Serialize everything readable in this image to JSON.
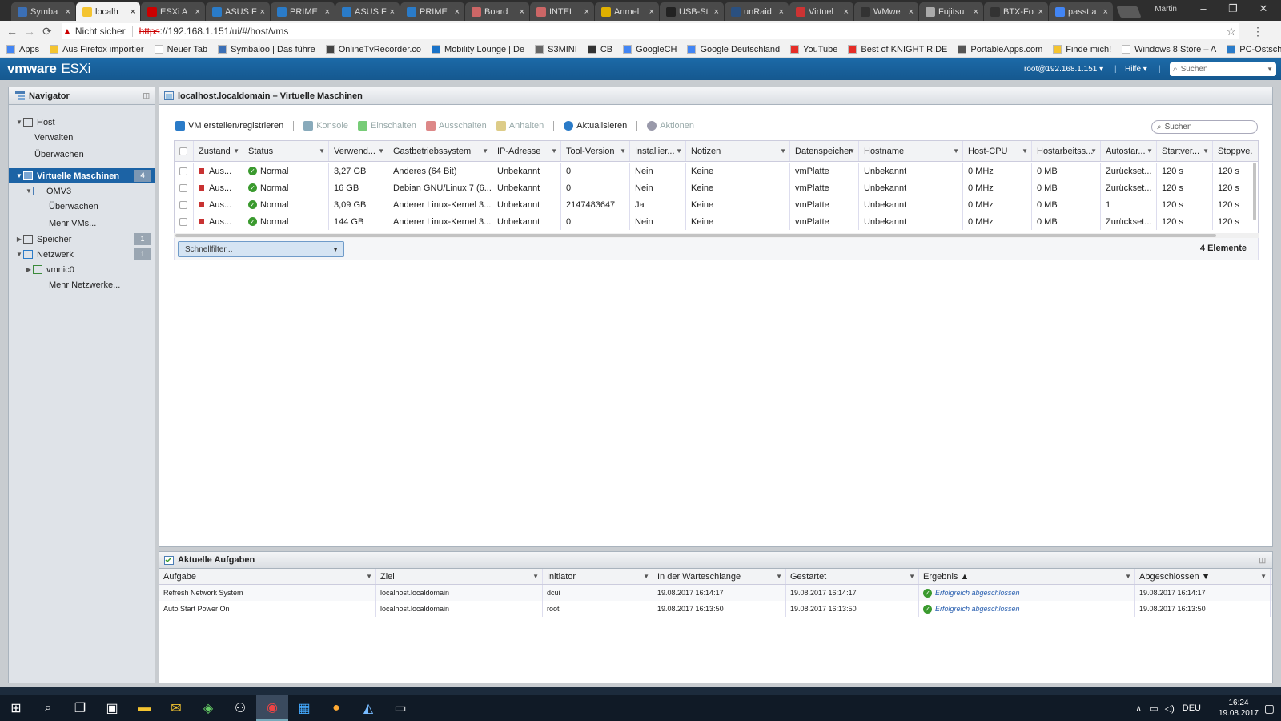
{
  "browser": {
    "tabs": [
      {
        "label": "Symba",
        "icon": "symbaloo",
        "active": false
      },
      {
        "label": "localh",
        "icon": "vmware",
        "active": true
      },
      {
        "label": "ESXi A",
        "icon": "esxi-x",
        "active": false
      },
      {
        "label": "ASUS F",
        "icon": "asus",
        "active": false
      },
      {
        "label": "PRIME",
        "icon": "prime",
        "active": false
      },
      {
        "label": "ASUS F",
        "icon": "asus",
        "active": false
      },
      {
        "label": "PRIME",
        "icon": "prime",
        "active": false
      },
      {
        "label": "Board",
        "icon": "board",
        "active": false
      },
      {
        "label": "INTEL",
        "icon": "intel",
        "active": false
      },
      {
        "label": "Anmel",
        "icon": "key",
        "active": false
      },
      {
        "label": "USB-St",
        "icon": "usb",
        "active": false
      },
      {
        "label": "unRaid",
        "icon": "unraid",
        "active": false
      },
      {
        "label": "Virtuel",
        "icon": "virt",
        "active": false
      },
      {
        "label": "WMwe",
        "icon": "wmw",
        "active": false
      },
      {
        "label": "Fujitsu",
        "icon": "page",
        "active": false
      },
      {
        "label": "BTX-Fo",
        "icon": "wiki",
        "active": false
      },
      {
        "label": "passt a",
        "icon": "google",
        "active": false
      }
    ],
    "window_user": "Martin",
    "security_label": "Nicht sicher",
    "url_protocol": "https",
    "url_rest": "://192.168.1.151/ui/#/host/vms",
    "bookmarks": [
      {
        "label": "Apps",
        "color": "#4285f4"
      },
      {
        "label": "Aus Firefox importier",
        "color": "#f4c430"
      },
      {
        "label": "Neuer Tab",
        "color": "#ffffff"
      },
      {
        "label": "Symbaloo | Das führe",
        "color": "#3b6fb5"
      },
      {
        "label": "OnlineTvRecorder.co",
        "color": "#444444"
      },
      {
        "label": "Mobility Lounge | De",
        "color": "#1a73c8"
      },
      {
        "label": "S3MINI",
        "color": "#666666"
      },
      {
        "label": "CB",
        "color": "#333333"
      },
      {
        "label": "GoogleCH",
        "color": "#4285f4"
      },
      {
        "label": "Google Deutschland",
        "color": "#4285f4"
      },
      {
        "label": "YouTube",
        "color": "#e52d27"
      },
      {
        "label": "Best of KNIGHT RIDE",
        "color": "#e52d27"
      },
      {
        "label": "PortableApps.com",
        "color": "#555555"
      },
      {
        "label": "Finde mich!",
        "color": "#f4c430"
      },
      {
        "label": "Windows 8 Store – A",
        "color": "#ffffff"
      },
      {
        "label": "PC-Ostschweiz - Gale",
        "color": "#2a7bc8"
      }
    ]
  },
  "esxi": {
    "logo_vm": "vmware",
    "logo_product": "ESXi",
    "user": "root@192.168.1.151 ▾",
    "help": "Hilfe ▾",
    "search_placeholder": "Suchen"
  },
  "navigator": {
    "title": "Navigator",
    "items": [
      {
        "label": "Host",
        "level": 0,
        "caret": "▼",
        "icon": "host",
        "count": "",
        "selected": false
      },
      {
        "label": "Verwalten",
        "level": 1,
        "caret": "",
        "icon": "",
        "count": "",
        "selected": false
      },
      {
        "label": "Überwachen",
        "level": 1,
        "caret": "",
        "icon": "",
        "count": "",
        "selected": false
      },
      {
        "label": "Virtuelle Maschinen",
        "level": 0,
        "caret": "▼",
        "icon": "vm",
        "count": "4",
        "selected": true
      },
      {
        "label": "OMV3",
        "level": 1,
        "caret": "▼",
        "icon": "vm-small",
        "count": "",
        "selected": false
      },
      {
        "label": "Überwachen",
        "level": 2,
        "caret": "",
        "icon": "",
        "count": "",
        "selected": false
      },
      {
        "label": "Mehr VMs...",
        "level": 2,
        "caret": "",
        "icon": "",
        "count": "",
        "selected": false
      },
      {
        "label": "Speicher",
        "level": 0,
        "caret": "▶",
        "icon": "storage",
        "count": "1",
        "selected": false
      },
      {
        "label": "Netzwerk",
        "level": 0,
        "caret": "▼",
        "icon": "network",
        "count": "1",
        "selected": false
      },
      {
        "label": "vmnic0",
        "level": 1,
        "caret": "▶",
        "icon": "nic",
        "count": "",
        "selected": false
      },
      {
        "label": "Mehr Netzwerke...",
        "level": 2,
        "caret": "",
        "icon": "",
        "count": "",
        "selected": false
      }
    ]
  },
  "main": {
    "title": "localhost.localdomain – Virtuelle Maschinen",
    "toolbar": [
      {
        "label": "VM erstellen/registrieren",
        "enabled": true,
        "icon": "create-vm"
      },
      {
        "label": "Konsole",
        "enabled": false,
        "icon": "console"
      },
      {
        "label": "Einschalten",
        "enabled": false,
        "icon": "power-on"
      },
      {
        "label": "Ausschalten",
        "enabled": false,
        "icon": "power-off"
      },
      {
        "label": "Anhalten",
        "enabled": false,
        "icon": "suspend"
      },
      {
        "label": "Aktualisieren",
        "enabled": true,
        "icon": "refresh"
      },
      {
        "label": "Aktionen",
        "enabled": false,
        "icon": "gear"
      }
    ],
    "search_placeholder": "Suchen",
    "columns": [
      "",
      "Zustand",
      "Status",
      "Verwend...",
      "Gastbetriebssystem",
      "IP-Adresse",
      "Tool-Version",
      "Installier...",
      "Notizen",
      "Datenspeicher",
      "Hostname",
      "Host-CPU",
      "Hostarbeitss...",
      "Autostar...",
      "Startver...",
      "Stoppve."
    ],
    "rows": [
      [
        "",
        "Aus...",
        "Normal",
        "3,27 GB",
        "Anderes (64 Bit)",
        "Unbekannt",
        "0",
        "Nein",
        "Keine",
        "vmPlatte",
        "Unbekannt",
        "0 MHz",
        "0 MB",
        "Zurückset...",
        "120 s",
        "120 s"
      ],
      [
        "",
        "Aus...",
        "Normal",
        "16 GB",
        "Debian GNU/Linux 7 (6...",
        "Unbekannt",
        "0",
        "Nein",
        "Keine",
        "vmPlatte",
        "Unbekannt",
        "0 MHz",
        "0 MB",
        "Zurückset...",
        "120 s",
        "120 s"
      ],
      [
        "",
        "Aus...",
        "Normal",
        "3,09 GB",
        "Anderer Linux-Kernel 3....",
        "Unbekannt",
        "2147483647",
        "Ja",
        "Keine",
        "vmPlatte",
        "Unbekannt",
        "0 MHz",
        "0 MB",
        "1",
        "120 s",
        "120 s"
      ],
      [
        "",
        "Aus...",
        "Normal",
        "144 GB",
        "Anderer Linux-Kernel 3....",
        "Unbekannt",
        "0",
        "Nein",
        "Keine",
        "vmPlatte",
        "Unbekannt",
        "0 MHz",
        "0 MB",
        "Zurückset...",
        "120 s",
        "120 s"
      ]
    ],
    "quickfilter": "Schnellfilter...",
    "element_count": "4 Elemente"
  },
  "tasks": {
    "title": "Aktuelle Aufgaben",
    "columns": [
      "Aufgabe",
      "Ziel",
      "Initiator",
      "In der Warteschlange",
      "Gestartet",
      "Ergebnis ▲",
      "Abgeschlossen ▼"
    ],
    "rows": [
      [
        "Refresh Network System",
        "localhost.localdomain",
        "dcui",
        "19.08.2017 16:14:17",
        "19.08.2017 16:14:17",
        "Erfolgreich abgeschlossen",
        "19.08.2017 16:14:17"
      ],
      [
        "Auto Start Power On",
        "localhost.localdomain",
        "root",
        "19.08.2017 16:13:50",
        "19.08.2017 16:13:50",
        "Erfolgreich abgeschlossen",
        "19.08.2017 16:13:50"
      ]
    ]
  },
  "taskbar": {
    "apps": [
      "windows-start",
      "search",
      "task-view",
      "store",
      "file-explorer",
      "mail",
      "app-green",
      "network-app",
      "chrome",
      "app-blue",
      "app-orange",
      "app-ship",
      "terminal"
    ],
    "language": "DEU",
    "time": "16:24",
    "date": "19.08.2017"
  }
}
